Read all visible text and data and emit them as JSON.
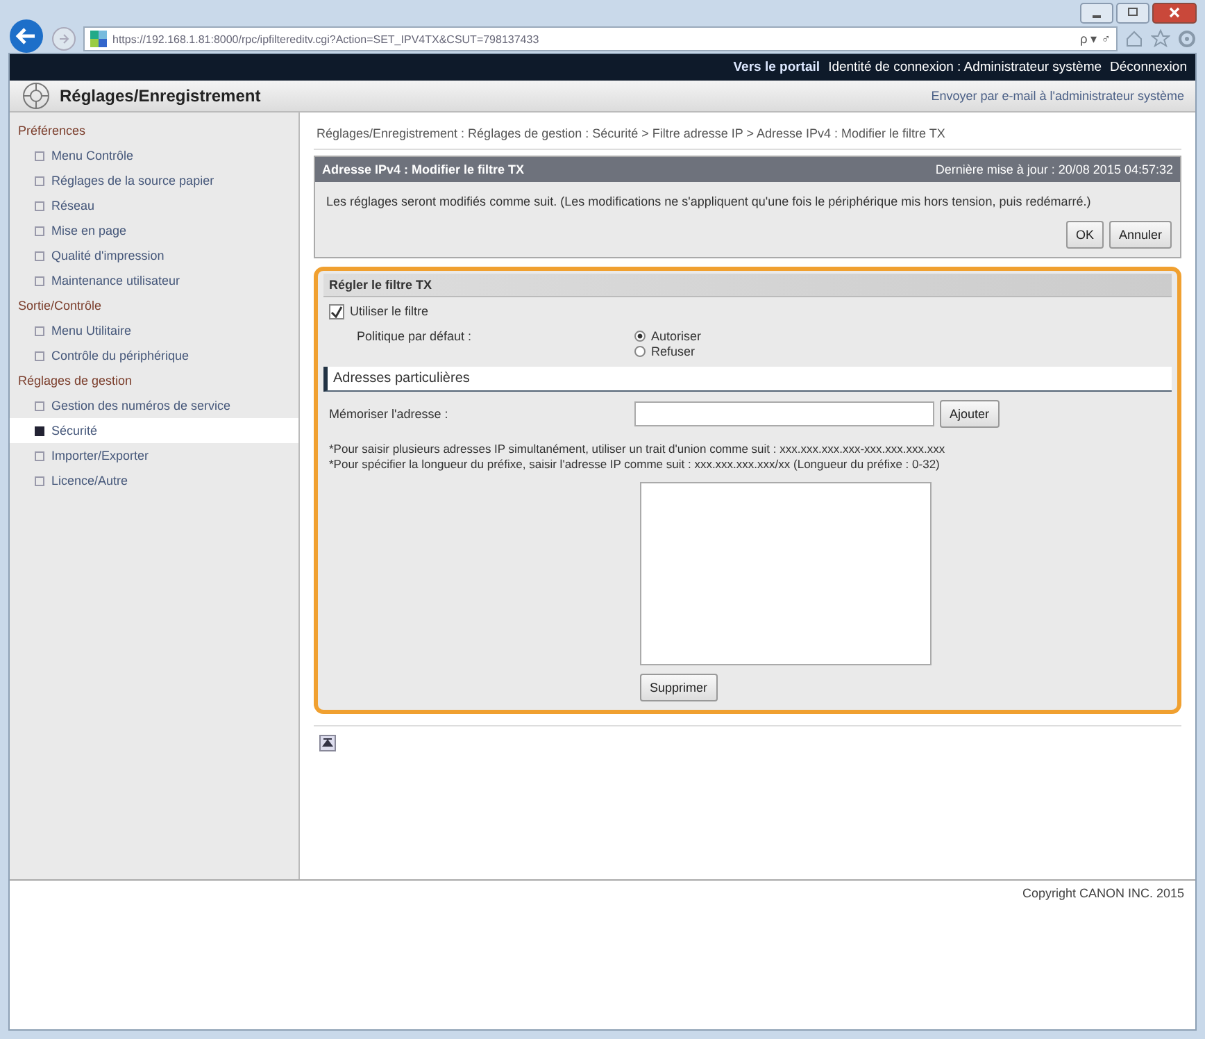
{
  "browser": {
    "url": "https://192.168.1.81:8000/rpc/ipfiltereditv.cgi?Action=SET_IPV4TX&CSUT=798137433",
    "search_glyph": "ρ ▾ ♂"
  },
  "top_bar": {
    "links": [
      "Vers le portail"
    ],
    "login_label": "Identité de connexion : Administrateur système",
    "logout": "Déconnexion"
  },
  "header": {
    "title": "Réglages/Enregistrement",
    "mail_link": "Envoyer par e-mail à l'administrateur système"
  },
  "sidebar": {
    "groups": [
      {
        "title": "Préférences",
        "items": [
          {
            "label": "Menu Contrôle",
            "selected": false
          },
          {
            "label": "Réglages de la source papier",
            "selected": false
          },
          {
            "label": "Réseau",
            "selected": false
          },
          {
            "label": "Mise en page",
            "selected": false
          },
          {
            "label": "Qualité d'impression",
            "selected": false
          },
          {
            "label": "Maintenance utilisateur",
            "selected": false
          }
        ]
      },
      {
        "title": "Sortie/Contrôle",
        "items": [
          {
            "label": "Menu Utilitaire",
            "selected": false
          },
          {
            "label": "Contrôle du périphérique",
            "selected": false
          }
        ]
      },
      {
        "title": "Réglages de gestion",
        "items": [
          {
            "label": "Gestion des numéros de service",
            "selected": false
          },
          {
            "label": "Sécurité",
            "selected": true
          },
          {
            "label": "Importer/Exporter",
            "selected": false
          },
          {
            "label": "Licence/Autre",
            "selected": false
          }
        ]
      }
    ]
  },
  "breadcrumb": "Réglages/Enregistrement : Réglages de gestion : Sécurité > Filtre adresse IP > Adresse IPv4 : Modifier le filtre TX",
  "panel": {
    "title": "Adresse IPv4 : Modifier le filtre TX",
    "updated": "Dernière mise à jour : 20/08 2015 04:57:32",
    "message": "Les réglages seront modifiés comme suit. (Les modifications ne s'appliquent qu'une fois le périphérique mis hors tension, puis redémarré.)",
    "buttons": [
      "OK",
      "Annuler"
    ]
  },
  "filter": {
    "title": "Régler le filtre TX",
    "use_filter": {
      "label": "Utiliser le filtre",
      "checked": true
    },
    "policy_label": "Politique par défaut :",
    "policy_options": [
      {
        "label": "Autoriser",
        "selected": true
      },
      {
        "label": "Refuser",
        "selected": false
      }
    ],
    "section_title": "Adresses particulières",
    "address_label": "Mémoriser l'adresse :",
    "add_button": "Ajouter",
    "notes": [
      "*Pour saisir plusieurs adresses IP simultanément, utiliser un trait d'union comme suit : xxx.xxx.xxx.xxx-xxx.xxx.xxx.xxx",
      "*Pour spécifier la longueur du préfixe, saisir l'adresse IP comme suit : xxx.xxx.xxx.xxx/xx (Longueur du préfixe : 0-32)"
    ],
    "delete_button": "Supprimer"
  },
  "footer": {
    "copyright": "Copyright CANON INC. 2015"
  }
}
